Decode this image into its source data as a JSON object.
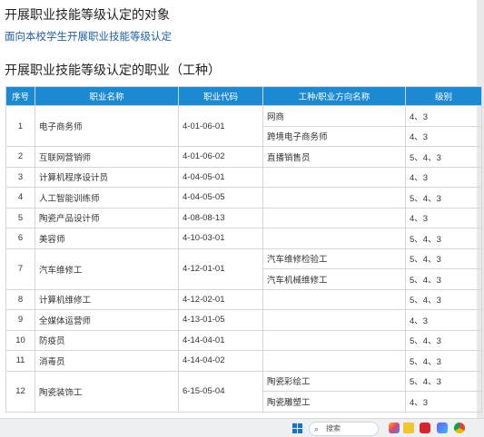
{
  "section1": {
    "title": "开展职业技能等级认定的对象",
    "subtitle": "面向本校学生开展职业技能等级认定"
  },
  "section2": {
    "title": "开展职业技能等级认定的职业（工种）"
  },
  "table": {
    "headers": [
      "序号",
      "职业名称",
      "职业代码",
      "工种/职业方向名称",
      "级别"
    ],
    "rows": [
      {
        "no": "1",
        "name": "电子商务师",
        "code": "4-01-06-01",
        "directions": [
          {
            "dir": "网商",
            "level": "4、3"
          },
          {
            "dir": "跨境电子商务师",
            "level": "4、3"
          }
        ]
      },
      {
        "no": "2",
        "name": "互联网营销师",
        "code": "4-01-06-02",
        "directions": [
          {
            "dir": "直播销售员",
            "level": "5、4、3"
          }
        ]
      },
      {
        "no": "3",
        "name": "计算机程序设计员",
        "code": "4-04-05-01",
        "directions": [
          {
            "dir": "",
            "level": "4、3"
          }
        ]
      },
      {
        "no": "4",
        "name": "人工智能训练师",
        "code": "4-04-05-05",
        "directions": [
          {
            "dir": "",
            "level": "5、4、3"
          }
        ]
      },
      {
        "no": "5",
        "name": "陶瓷产品设计师",
        "code": "4-08-08-13",
        "directions": [
          {
            "dir": "",
            "level": "4、3"
          }
        ]
      },
      {
        "no": "6",
        "name": "美容师",
        "code": "4-10-03-01",
        "directions": [
          {
            "dir": "",
            "level": "5、4、3"
          }
        ]
      },
      {
        "no": "7",
        "name": "汽车维修工",
        "code": "4-12-01-01",
        "directions": [
          {
            "dir": "汽车维修检验工",
            "level": "5、4、3"
          },
          {
            "dir": "汽车机械维修工",
            "level": "5、4、3"
          }
        ]
      },
      {
        "no": "8",
        "name": "计算机维修工",
        "code": "4-12-02-01",
        "directions": [
          {
            "dir": "",
            "level": "5、4、3"
          }
        ]
      },
      {
        "no": "9",
        "name": "全媒体运营师",
        "code": "4-13-01-05",
        "directions": [
          {
            "dir": "",
            "level": "4、3"
          }
        ]
      },
      {
        "no": "10",
        "name": "防疫员",
        "code": "4-14-04-01",
        "directions": [
          {
            "dir": "",
            "level": "5、4、3"
          }
        ]
      },
      {
        "no": "11",
        "name": "消毒员",
        "code": "4-14-04-02",
        "directions": [
          {
            "dir": "",
            "level": "5、4、3"
          }
        ]
      },
      {
        "no": "12",
        "name": "陶瓷装饰工",
        "code": "6-15-05-04",
        "directions": [
          {
            "dir": "陶瓷彩绘工",
            "level": "5、4、3"
          },
          {
            "dir": "陶瓷雕塑工",
            "level": "4、3"
          }
        ]
      }
    ]
  },
  "taskbar": {
    "search_label": "搜索",
    "apps": [
      "colorful-app-icon",
      "file-explorer-icon",
      "wps-icon",
      "ai-assistant-icon",
      "chrome-icon"
    ],
    "colors": {
      "accent": "#1b8ad3",
      "link": "#1d5fa8"
    }
  }
}
